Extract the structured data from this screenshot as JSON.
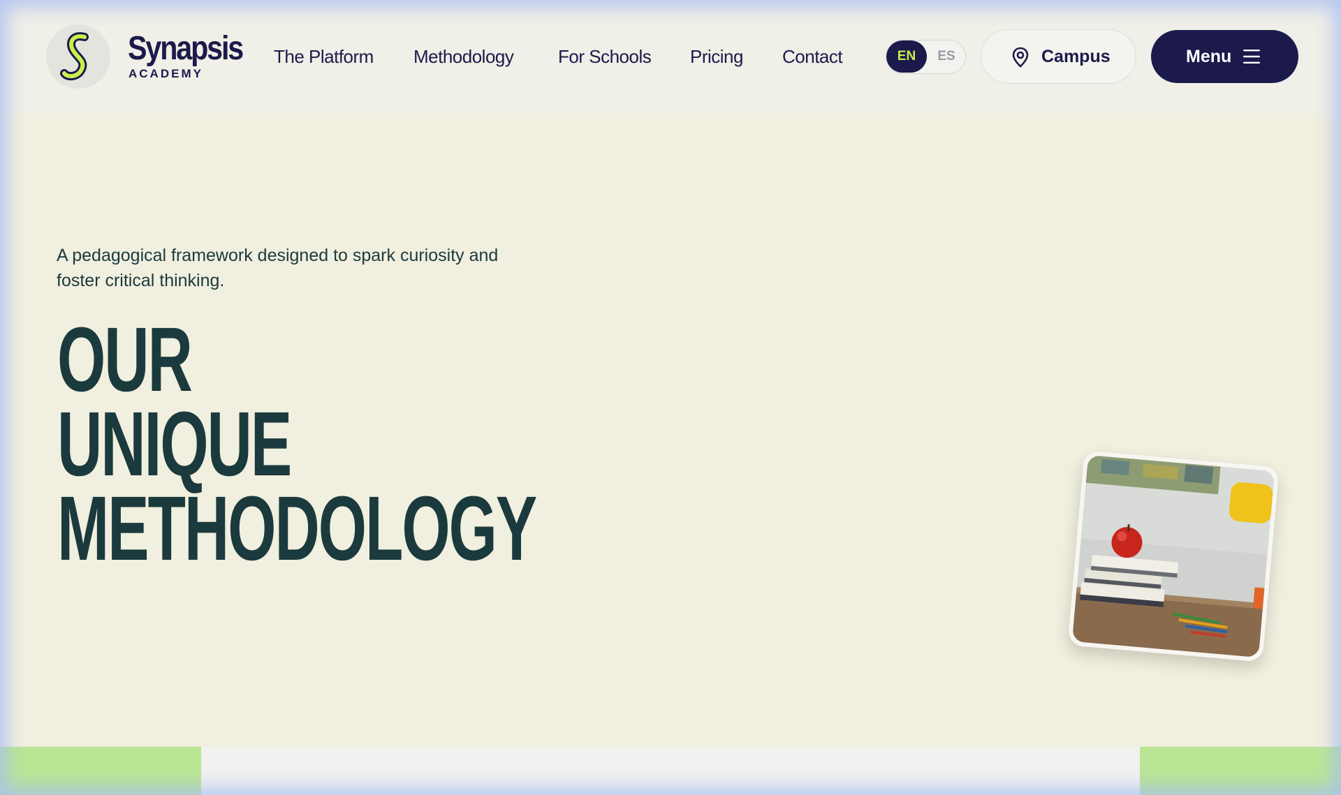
{
  "brand": {
    "name": "Synapsis",
    "subtitle": "ACADEMY",
    "accent_color": "#c9f04a",
    "primary_color": "#1b1a4b"
  },
  "nav": {
    "items": [
      {
        "label": "The Platform"
      },
      {
        "label": "Methodology"
      },
      {
        "label": "For Schools"
      },
      {
        "label": "Pricing"
      },
      {
        "label": "Contact"
      }
    ]
  },
  "language": {
    "options": [
      "EN",
      "ES"
    ],
    "selected": "EN"
  },
  "campus_button": {
    "label": "Campus",
    "icon": "map-pin-icon"
  },
  "menu_button": {
    "label": "Menu",
    "icon": "hamburger-icon"
  },
  "hero": {
    "tagline": "A pedagogical framework designed to spark curiosity and foster critical thinking.",
    "headline_lines": [
      "OUR",
      "UNIQUE",
      "METHODOLOGY"
    ],
    "headline_color": "#1b3a3d",
    "photo_description_icon": "apple-on-books-photo"
  }
}
